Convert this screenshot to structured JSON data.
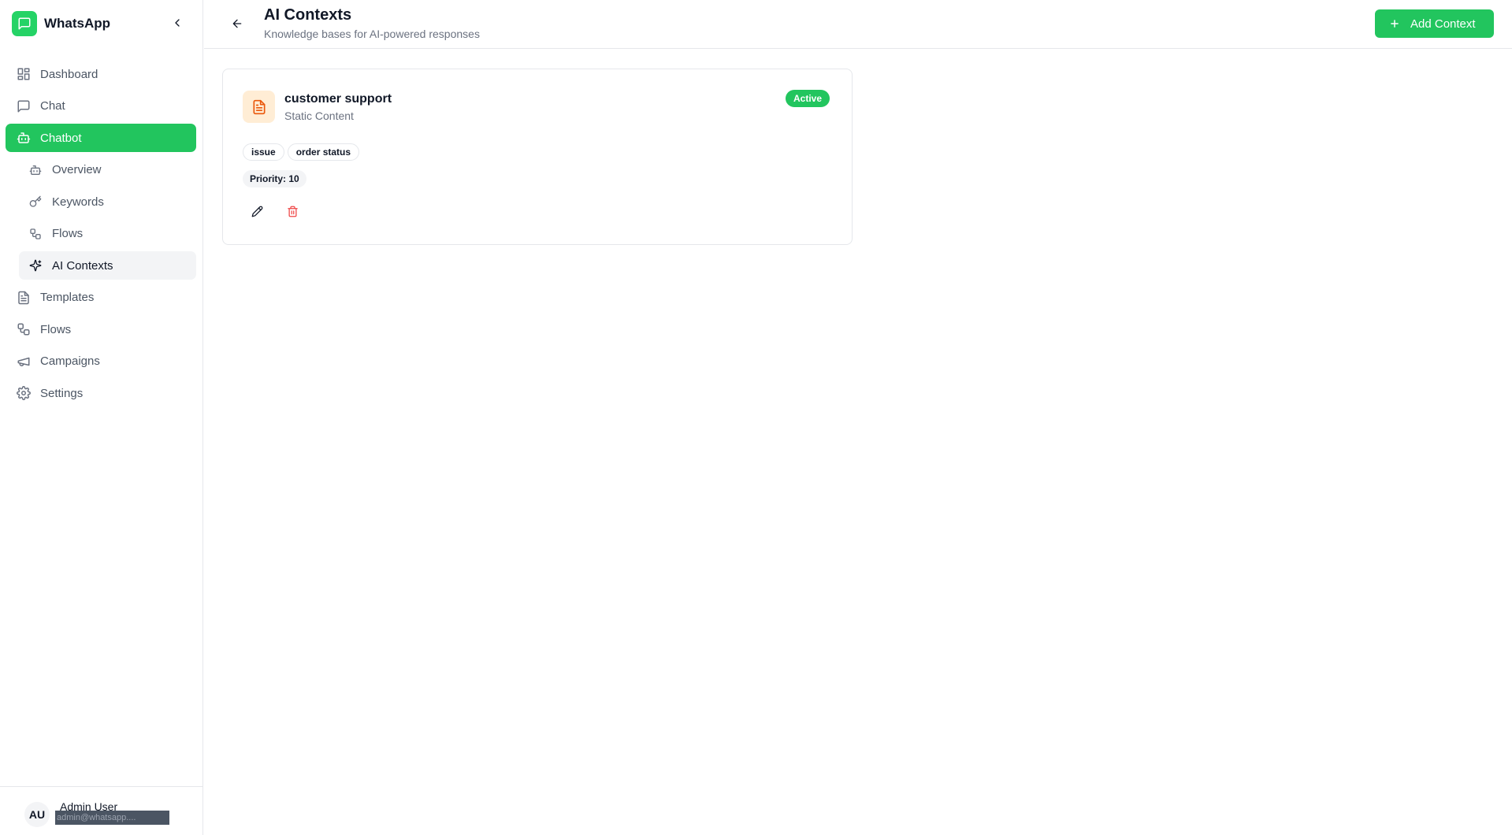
{
  "app": {
    "name": "WhatsApp"
  },
  "sidebar": {
    "items": [
      {
        "label": "Dashboard",
        "icon": "dashboard-icon"
      },
      {
        "label": "Chat",
        "icon": "chat-icon"
      },
      {
        "label": "Chatbot",
        "icon": "bot-icon",
        "active": true
      },
      {
        "label": "Templates",
        "icon": "file-text-icon"
      },
      {
        "label": "Flows",
        "icon": "workflow-icon"
      },
      {
        "label": "Campaigns",
        "icon": "megaphone-icon"
      },
      {
        "label": "Settings",
        "icon": "gear-icon"
      }
    ],
    "chatbot_subitems": [
      {
        "label": "Overview",
        "icon": "bot-icon"
      },
      {
        "label": "Keywords",
        "icon": "key-icon"
      },
      {
        "label": "Flows",
        "icon": "workflow-icon"
      },
      {
        "label": "AI Contexts",
        "icon": "sparkles-icon",
        "current": true
      }
    ]
  },
  "user": {
    "initials": "AU",
    "name": "Admin User",
    "email": "admin@whatsapp...."
  },
  "header": {
    "title": "AI Contexts",
    "subtitle": "Knowledge bases for AI-powered responses",
    "add_button_label": "Add Context"
  },
  "contexts": [
    {
      "title": "customer support",
      "type": "Static Content",
      "status": "Active",
      "tags": [
        "issue",
        "order status"
      ],
      "priority_label": "Priority: 10"
    }
  ],
  "colors": {
    "accent": "#22c55e",
    "brand": "#25d366",
    "icon_bg": "#ffedd5",
    "icon_fg": "#ea580c",
    "danger": "#ef4444"
  }
}
